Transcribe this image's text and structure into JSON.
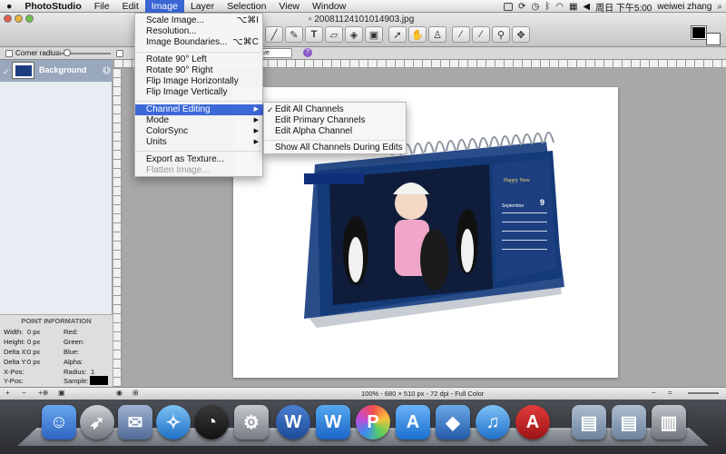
{
  "menubar": {
    "apple": "",
    "items": [
      "PhotoStudio",
      "File",
      "Edit",
      "Image",
      "Layer",
      "Selection",
      "View",
      "Window"
    ],
    "clock": "周日 下午5:00",
    "user": "weiwei zhang"
  },
  "window": {
    "title": "200811241010​14903.jpg"
  },
  "options": {
    "corner_label": "Corner radius: 8",
    "select_value": "ive"
  },
  "layers": {
    "layer_name": "Background"
  },
  "point_info": {
    "title": "POINT INFORMATION",
    "width_label": "Width:",
    "width_val": "0 px",
    "height_label": "Height:",
    "height_val": "0 px",
    "dx_label": "Delta X:",
    "dx_val": "0 px",
    "dy_label": "Delta Y:",
    "dy_val": "0 px",
    "xpos_label": "X-Pos:",
    "ypos_label": "Y-Pos:",
    "red": "Red:",
    "green": "Green:",
    "blue": "Blue:",
    "alpha": "Alpha:",
    "radius_label": "Radius:",
    "radius_val": "1",
    "sample_label": "Sample:"
  },
  "status": {
    "text": "100% - 680 × 510 px - 72 dpi - Full Color"
  },
  "image_menu": {
    "items": [
      {
        "label": "Scale Image...",
        "shortcut": "⌥⌘I"
      },
      {
        "label": "Resolution...",
        "shortcut": ""
      },
      {
        "label": "Image Boundaries...",
        "shortcut": "⌥⌘C"
      },
      {
        "label": "Rotate 90° Left",
        "shortcut": ""
      },
      {
        "label": "Rotate 90° Right",
        "shortcut": ""
      },
      {
        "label": "Flip Image Horizontally",
        "shortcut": ""
      },
      {
        "label": "Flip Image Vertically",
        "shortcut": ""
      },
      {
        "label": "Channel Editing",
        "shortcut": ""
      },
      {
        "label": "Mode",
        "shortcut": ""
      },
      {
        "label": "ColorSync",
        "shortcut": ""
      },
      {
        "label": "Units",
        "shortcut": ""
      },
      {
        "label": "Export as Texture...",
        "shortcut": ""
      },
      {
        "label": "Flatten Image...",
        "shortcut": ""
      }
    ]
  },
  "channel_menu": {
    "items": [
      "Edit All Channels",
      "Edit Primary Channels",
      "Edit Alpha Channel",
      "Show All Channels During Edits"
    ],
    "checked": "Edit All Channels"
  },
  "artwork": {
    "calendar_month_label": "September",
    "calendar_day": "9",
    "banner_text": "Happy New"
  },
  "colors": {
    "selection": "#3c69d8",
    "calendar_blue": "#1d3f80"
  }
}
